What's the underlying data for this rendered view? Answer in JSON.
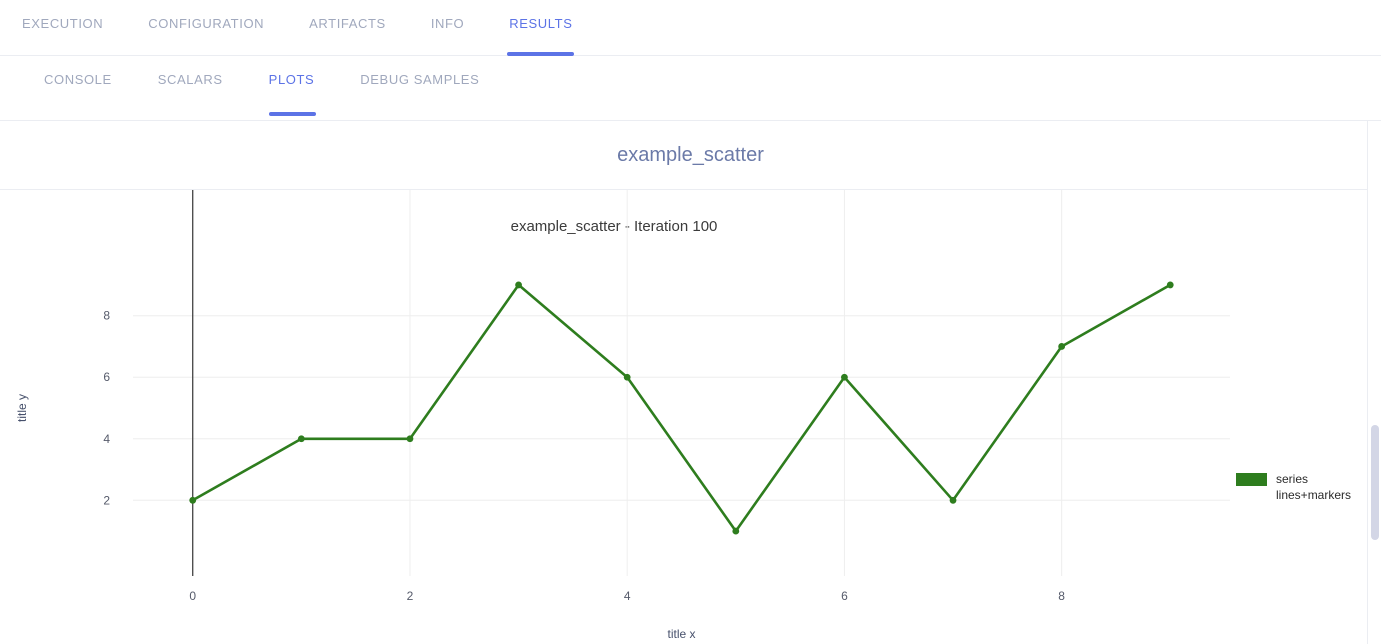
{
  "main_tabs": [
    {
      "label": "EXECUTION",
      "active": false
    },
    {
      "label": "CONFIGURATION",
      "active": false
    },
    {
      "label": "ARTIFACTS",
      "active": false
    },
    {
      "label": "INFO",
      "active": false
    },
    {
      "label": "RESULTS",
      "active": true
    }
  ],
  "sub_tabs": [
    {
      "label": "CONSOLE",
      "active": false
    },
    {
      "label": "SCALARS",
      "active": false
    },
    {
      "label": "PLOTS",
      "active": true
    },
    {
      "label": "DEBUG SAMPLES",
      "active": false
    }
  ],
  "plot_card": {
    "header_title": "example_scatter"
  },
  "legend": {
    "swatch_color": "#2E7D1E",
    "name": "series",
    "mode": "lines+markers"
  },
  "colors": {
    "accent": "#5c73e6",
    "inactive_tab": "#a0a8bd",
    "header_title": "#6b7aa8",
    "series": "#2E7D1E",
    "gridline": "#eeeeee",
    "axis": "#333333"
  },
  "chart_data": {
    "type": "line",
    "title": "example_scatter - Iteration 100",
    "xlabel": "title x",
    "ylabel": "title y",
    "mode": "lines+markers",
    "grid": true,
    "legend_position": "right",
    "x": [
      0,
      1,
      2,
      3,
      4,
      5,
      6,
      7,
      8,
      9
    ],
    "xticks": [
      0,
      2,
      4,
      6,
      8
    ],
    "yticks": [
      2,
      4,
      6,
      8
    ],
    "xlim": [
      -0.55,
      9.55
    ],
    "ylim": [
      0.45,
      9.55
    ],
    "series": [
      {
        "name": "series",
        "color": "#2E7D1E",
        "values": [
          2,
          4,
          4,
          9,
          6,
          1,
          6,
          2,
          7,
          9
        ]
      }
    ]
  }
}
